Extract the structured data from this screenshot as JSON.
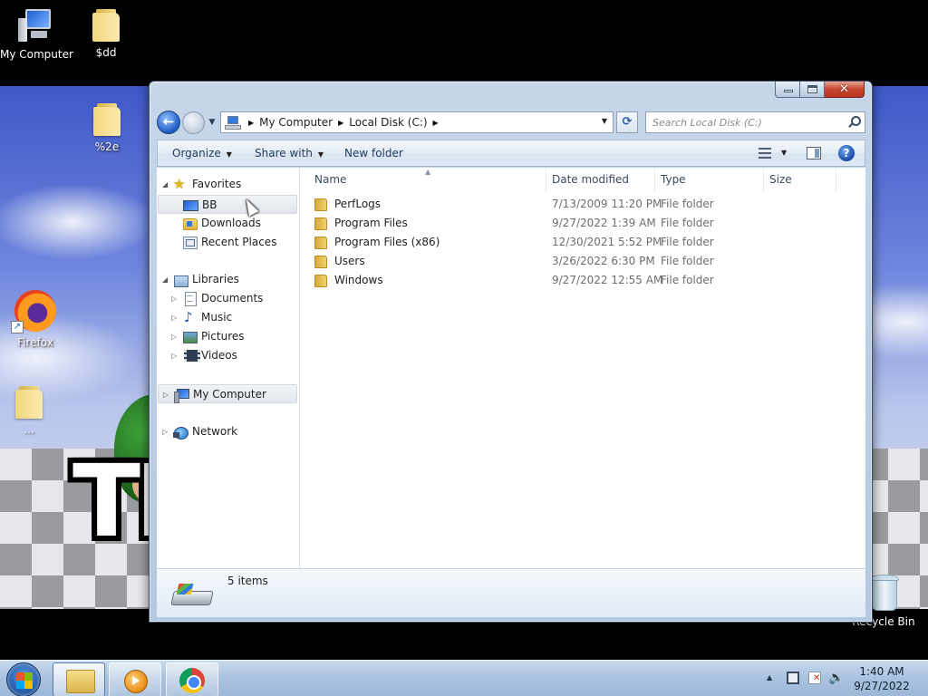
{
  "desktop": {
    "icons": [
      {
        "label": "My Computer"
      },
      {
        "label": "$dd"
      },
      {
        "label": "%2e"
      },
      {
        "label": "Firefox"
      },
      {
        "label": "..."
      },
      {
        "label": "Recycle Bin"
      }
    ],
    "wallpaper_text": "TI"
  },
  "window": {
    "caption_buttons": {
      "minimize": "minimize-icon",
      "maximize": "maximize-icon",
      "close": "✕"
    },
    "address": {
      "crumbs": [
        "My Computer",
        "Local Disk (C:)"
      ],
      "separator": "▶",
      "dropdown": "▼"
    },
    "nav_buttons": {
      "back": "←",
      "history": "▼",
      "refresh": "⟳"
    },
    "search": {
      "placeholder": "Search Local Disk (C:)"
    },
    "toolbar": {
      "organize": "Organize",
      "share_with": "Share with",
      "new_folder": "New folder",
      "caret": "▼",
      "help": "?"
    },
    "nav_pane": {
      "favorites": {
        "label": "Favorites",
        "items": [
          "BB",
          "Downloads",
          "Recent Places"
        ]
      },
      "libraries": {
        "label": "Libraries",
        "items": [
          "Documents",
          "Music",
          "Pictures",
          "Videos"
        ]
      },
      "computer": "My Computer",
      "network": "Network",
      "expanded_arrow": "◢",
      "collapsed_arrow": "▷"
    },
    "columns": [
      "Name",
      "Date modified",
      "Type",
      "Size"
    ],
    "sort_indicator": "▲",
    "files": [
      {
        "name": "PerfLogs",
        "date": "7/13/2009 11:20 PM",
        "type": "File folder",
        "size": ""
      },
      {
        "name": "Program Files",
        "date": "9/27/2022 1:39 AM",
        "type": "File folder",
        "size": ""
      },
      {
        "name": "Program Files (x86)",
        "date": "12/30/2021 5:52 PM",
        "type": "File folder",
        "size": ""
      },
      {
        "name": "Users",
        "date": "3/26/2022 6:30 PM",
        "type": "File folder",
        "size": ""
      },
      {
        "name": "Windows",
        "date": "9/27/2022 12:55 AM",
        "type": "File folder",
        "size": ""
      }
    ],
    "status": {
      "item_count": "5 items"
    }
  },
  "taskbar": {
    "clock": {
      "time": "1:40 AM",
      "date": "9/27/2022"
    },
    "tray_expand": "▲",
    "volume": "🔈"
  }
}
